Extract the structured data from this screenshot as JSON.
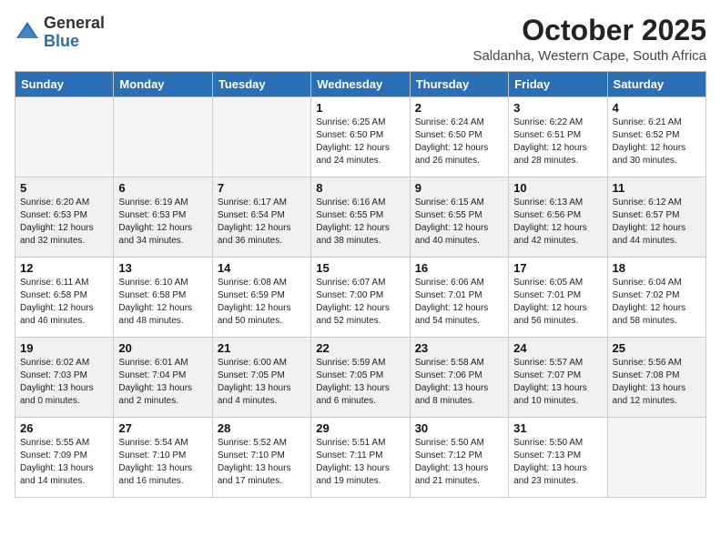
{
  "logo": {
    "general": "General",
    "blue": "Blue"
  },
  "header": {
    "month": "October 2025",
    "location": "Saldanha, Western Cape, South Africa"
  },
  "days_of_week": [
    "Sunday",
    "Monday",
    "Tuesday",
    "Wednesday",
    "Thursday",
    "Friday",
    "Saturday"
  ],
  "weeks": [
    [
      {
        "day": "",
        "info": ""
      },
      {
        "day": "",
        "info": ""
      },
      {
        "day": "",
        "info": ""
      },
      {
        "day": "1",
        "info": "Sunrise: 6:25 AM\nSunset: 6:50 PM\nDaylight: 12 hours\nand 24 minutes."
      },
      {
        "day": "2",
        "info": "Sunrise: 6:24 AM\nSunset: 6:50 PM\nDaylight: 12 hours\nand 26 minutes."
      },
      {
        "day": "3",
        "info": "Sunrise: 6:22 AM\nSunset: 6:51 PM\nDaylight: 12 hours\nand 28 minutes."
      },
      {
        "day": "4",
        "info": "Sunrise: 6:21 AM\nSunset: 6:52 PM\nDaylight: 12 hours\nand 30 minutes."
      }
    ],
    [
      {
        "day": "5",
        "info": "Sunrise: 6:20 AM\nSunset: 6:53 PM\nDaylight: 12 hours\nand 32 minutes."
      },
      {
        "day": "6",
        "info": "Sunrise: 6:19 AM\nSunset: 6:53 PM\nDaylight: 12 hours\nand 34 minutes."
      },
      {
        "day": "7",
        "info": "Sunrise: 6:17 AM\nSunset: 6:54 PM\nDaylight: 12 hours\nand 36 minutes."
      },
      {
        "day": "8",
        "info": "Sunrise: 6:16 AM\nSunset: 6:55 PM\nDaylight: 12 hours\nand 38 minutes."
      },
      {
        "day": "9",
        "info": "Sunrise: 6:15 AM\nSunset: 6:55 PM\nDaylight: 12 hours\nand 40 minutes."
      },
      {
        "day": "10",
        "info": "Sunrise: 6:13 AM\nSunset: 6:56 PM\nDaylight: 12 hours\nand 42 minutes."
      },
      {
        "day": "11",
        "info": "Sunrise: 6:12 AM\nSunset: 6:57 PM\nDaylight: 12 hours\nand 44 minutes."
      }
    ],
    [
      {
        "day": "12",
        "info": "Sunrise: 6:11 AM\nSunset: 6:58 PM\nDaylight: 12 hours\nand 46 minutes."
      },
      {
        "day": "13",
        "info": "Sunrise: 6:10 AM\nSunset: 6:58 PM\nDaylight: 12 hours\nand 48 minutes."
      },
      {
        "day": "14",
        "info": "Sunrise: 6:08 AM\nSunset: 6:59 PM\nDaylight: 12 hours\nand 50 minutes."
      },
      {
        "day": "15",
        "info": "Sunrise: 6:07 AM\nSunset: 7:00 PM\nDaylight: 12 hours\nand 52 minutes."
      },
      {
        "day": "16",
        "info": "Sunrise: 6:06 AM\nSunset: 7:01 PM\nDaylight: 12 hours\nand 54 minutes."
      },
      {
        "day": "17",
        "info": "Sunrise: 6:05 AM\nSunset: 7:01 PM\nDaylight: 12 hours\nand 56 minutes."
      },
      {
        "day": "18",
        "info": "Sunrise: 6:04 AM\nSunset: 7:02 PM\nDaylight: 12 hours\nand 58 minutes."
      }
    ],
    [
      {
        "day": "19",
        "info": "Sunrise: 6:02 AM\nSunset: 7:03 PM\nDaylight: 13 hours\nand 0 minutes."
      },
      {
        "day": "20",
        "info": "Sunrise: 6:01 AM\nSunset: 7:04 PM\nDaylight: 13 hours\nand 2 minutes."
      },
      {
        "day": "21",
        "info": "Sunrise: 6:00 AM\nSunset: 7:05 PM\nDaylight: 13 hours\nand 4 minutes."
      },
      {
        "day": "22",
        "info": "Sunrise: 5:59 AM\nSunset: 7:05 PM\nDaylight: 13 hours\nand 6 minutes."
      },
      {
        "day": "23",
        "info": "Sunrise: 5:58 AM\nSunset: 7:06 PM\nDaylight: 13 hours\nand 8 minutes."
      },
      {
        "day": "24",
        "info": "Sunrise: 5:57 AM\nSunset: 7:07 PM\nDaylight: 13 hours\nand 10 minutes."
      },
      {
        "day": "25",
        "info": "Sunrise: 5:56 AM\nSunset: 7:08 PM\nDaylight: 13 hours\nand 12 minutes."
      }
    ],
    [
      {
        "day": "26",
        "info": "Sunrise: 5:55 AM\nSunset: 7:09 PM\nDaylight: 13 hours\nand 14 minutes."
      },
      {
        "day": "27",
        "info": "Sunrise: 5:54 AM\nSunset: 7:10 PM\nDaylight: 13 hours\nand 16 minutes."
      },
      {
        "day": "28",
        "info": "Sunrise: 5:52 AM\nSunset: 7:10 PM\nDaylight: 13 hours\nand 17 minutes."
      },
      {
        "day": "29",
        "info": "Sunrise: 5:51 AM\nSunset: 7:11 PM\nDaylight: 13 hours\nand 19 minutes."
      },
      {
        "day": "30",
        "info": "Sunrise: 5:50 AM\nSunset: 7:12 PM\nDaylight: 13 hours\nand 21 minutes."
      },
      {
        "day": "31",
        "info": "Sunrise: 5:50 AM\nSunset: 7:13 PM\nDaylight: 13 hours\nand 23 minutes."
      },
      {
        "day": "",
        "info": ""
      }
    ]
  ]
}
